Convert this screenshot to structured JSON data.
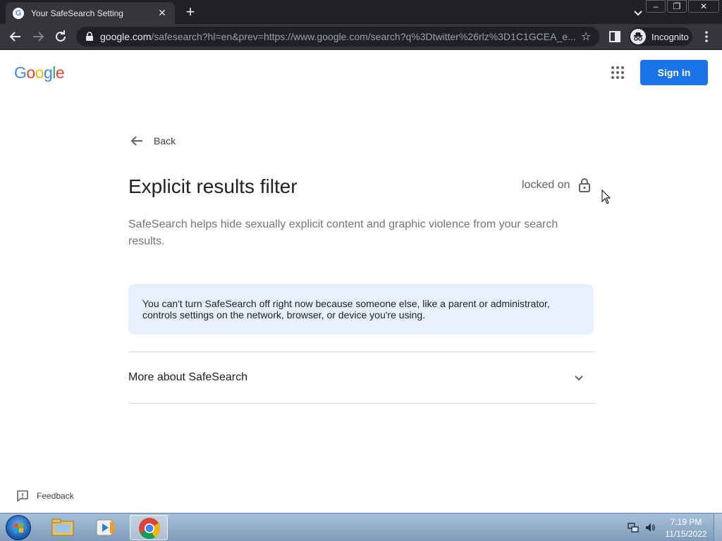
{
  "browser": {
    "tab_title": "Your SafeSearch Setting",
    "url_host": "google.com",
    "url_path": "/safesearch?hl=en&prev=https://www.google.com/search?q%3Dtwitter%26rlz%3D1C1GCEA_e...",
    "profile_label": "Incognito"
  },
  "header": {
    "logo": [
      {
        "char": "G",
        "color": "#4285f4"
      },
      {
        "char": "o",
        "color": "#ea4335"
      },
      {
        "char": "o",
        "color": "#fbbc05"
      },
      {
        "char": "g",
        "color": "#4285f4"
      },
      {
        "char": "l",
        "color": "#34a853"
      },
      {
        "char": "e",
        "color": "#ea4335"
      }
    ],
    "sign_in_label": "Sign in"
  },
  "main": {
    "back_label": "Back",
    "title": "Explicit results filter",
    "status_label": "locked on",
    "description": "SafeSearch helps hide sexually explicit content and graphic violence from your search results.",
    "notice": "You can't turn SafeSearch off right now because someone else, like a parent or administrator, controls settings on the network, browser, or device you're using.",
    "more_label": "More about SafeSearch"
  },
  "footer": {
    "feedback_label": "Feedback"
  },
  "taskbar": {
    "time": "7:19 PM",
    "date": "11/15/2022"
  },
  "colors": {
    "accent": "#1a73e8",
    "notice_bg": "#e8f0fe"
  }
}
